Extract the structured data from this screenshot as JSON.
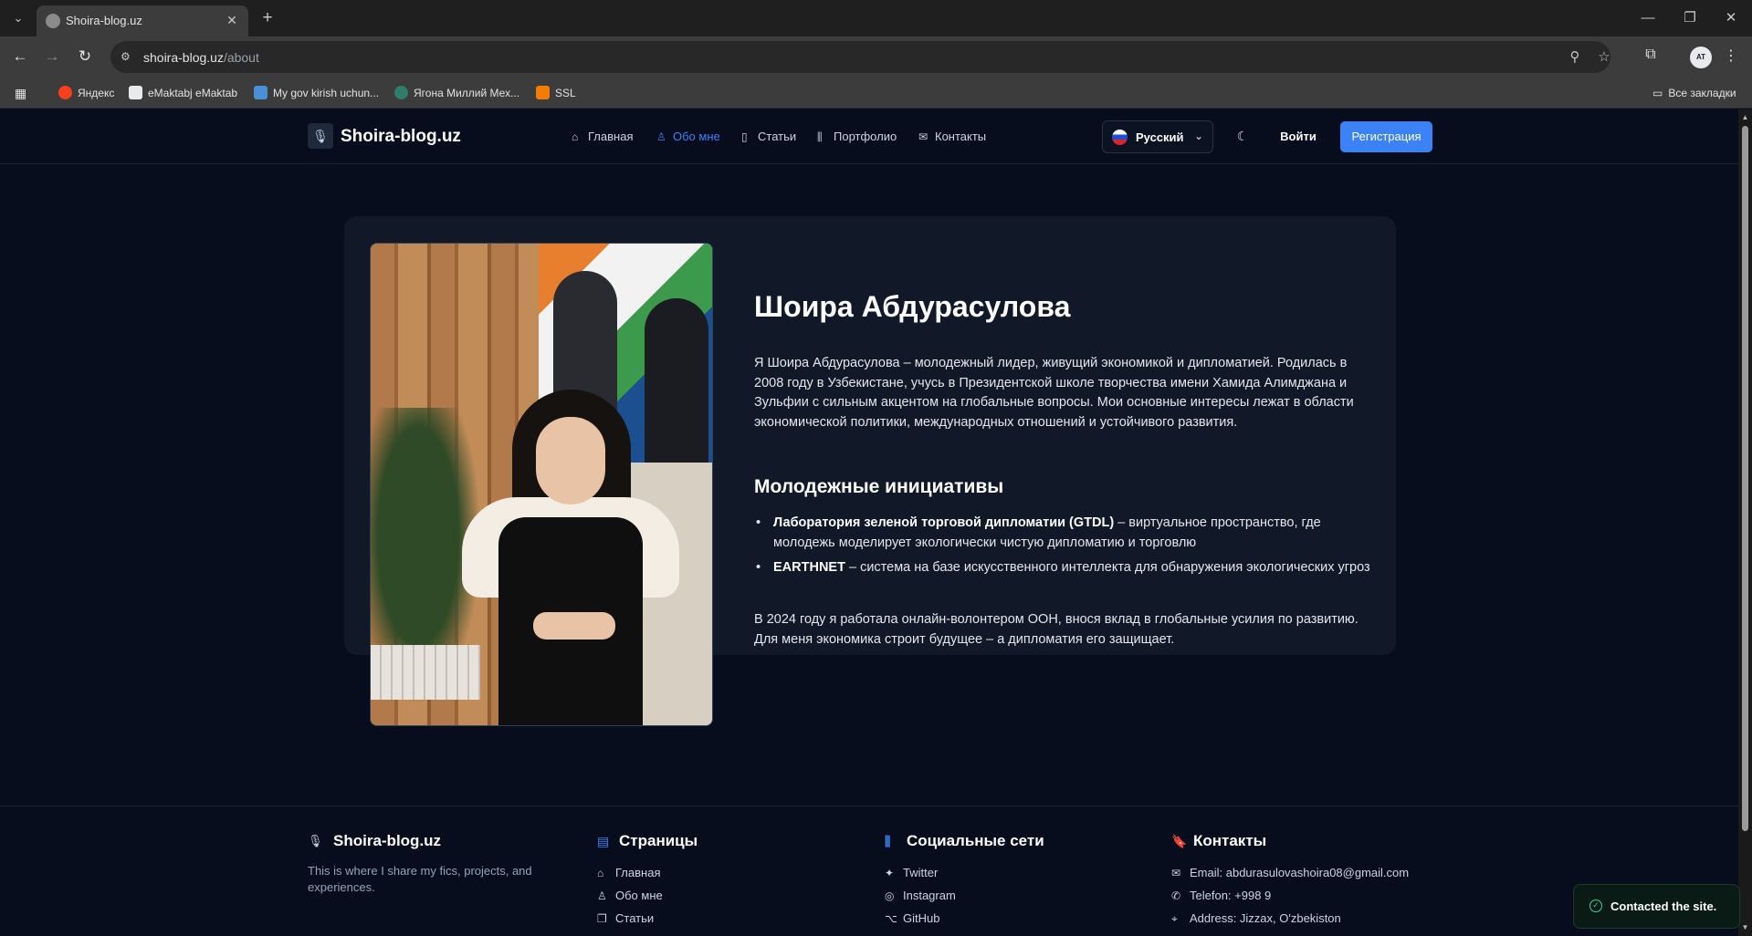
{
  "browser": {
    "tab_title": "Shoira-blog.uz",
    "url_host": "shoira-blog.uz",
    "url_path": "/about",
    "bookmarks": [
      {
        "label": "Яндекс",
        "color": "#fc3f1d"
      },
      {
        "label": "eMaktabj eMaktab",
        "color": "#e8eaed"
      },
      {
        "label": "My gov kirish uchun...",
        "color": "#4a90d9"
      },
      {
        "label": "Ягона Миллий Мех...",
        "color": "#2e7d6b"
      },
      {
        "label": "SSL",
        "color": "#f57c00"
      }
    ],
    "all_bookmarks": "Все закладки",
    "profile_initials": "AT"
  },
  "site": {
    "logo": "Shoira-blog.uz",
    "nav": [
      {
        "label": "Главная",
        "icon": "home-icon"
      },
      {
        "label": "Обо мне",
        "icon": "user-icon",
        "active": true
      },
      {
        "label": "Статьи",
        "icon": "book-icon"
      },
      {
        "label": "Портфолио",
        "icon": "library-icon"
      },
      {
        "label": "Контакты",
        "icon": "mail-icon"
      }
    ],
    "language": "Русский",
    "login": "Войти",
    "register": "Регистрация",
    "accent_color": "#3b82f6"
  },
  "about": {
    "name": "Шоира Абдурасулова",
    "bio": "Я Шоира Абдурасулова – молодежный лидер, живущий экономикой и дипломатией. Родилась в 2008 году в Узбекистане, учусь в Президентской школе творчества имени Хамида Алимджана и Зульфии с сильным акцентом на глобальные вопросы. Мои основные интересы лежат в области экономической политики, международных отношений и устойчивого развития.",
    "initiatives_title": "Молодежные инициативы",
    "initiatives": [
      {
        "name": "Лаборатория зеленой торговой дипломатии (GTDL)",
        "desc": " – виртуальное пространство, где молодежь моделирует экологически чистую дипломатию и торговлю"
      },
      {
        "name": "EARTHNET",
        "desc": " – система на базе искусственного интеллекта для обнаружения экологических угроз"
      }
    ],
    "outro_1": "В 2024 году я работала онлайн-волонтером ООН, внося вклад в глобальные усилия по развитию.",
    "outro_2": "Для меня экономика строит будущее – а дипломатия его защищает."
  },
  "footer": {
    "logo": "Shoira-blog.uz",
    "tagline": "This is where I share my fics, projects, and experiences.",
    "pages_title": "Страницы",
    "pages": [
      "Главная",
      "Обо мне",
      "Статьи"
    ],
    "social_title": "Социальные сети",
    "social": [
      "Twitter",
      "Instagram",
      "GitHub"
    ],
    "contacts_title": "Контакты",
    "contacts": [
      "Email: abdurasulovashoira08@gmail.com",
      "Telefon: +998 9",
      "Address: Jizzax, O'zbekiston"
    ]
  },
  "toast": {
    "message": "Contacted the site.",
    "color": "#34d399"
  }
}
